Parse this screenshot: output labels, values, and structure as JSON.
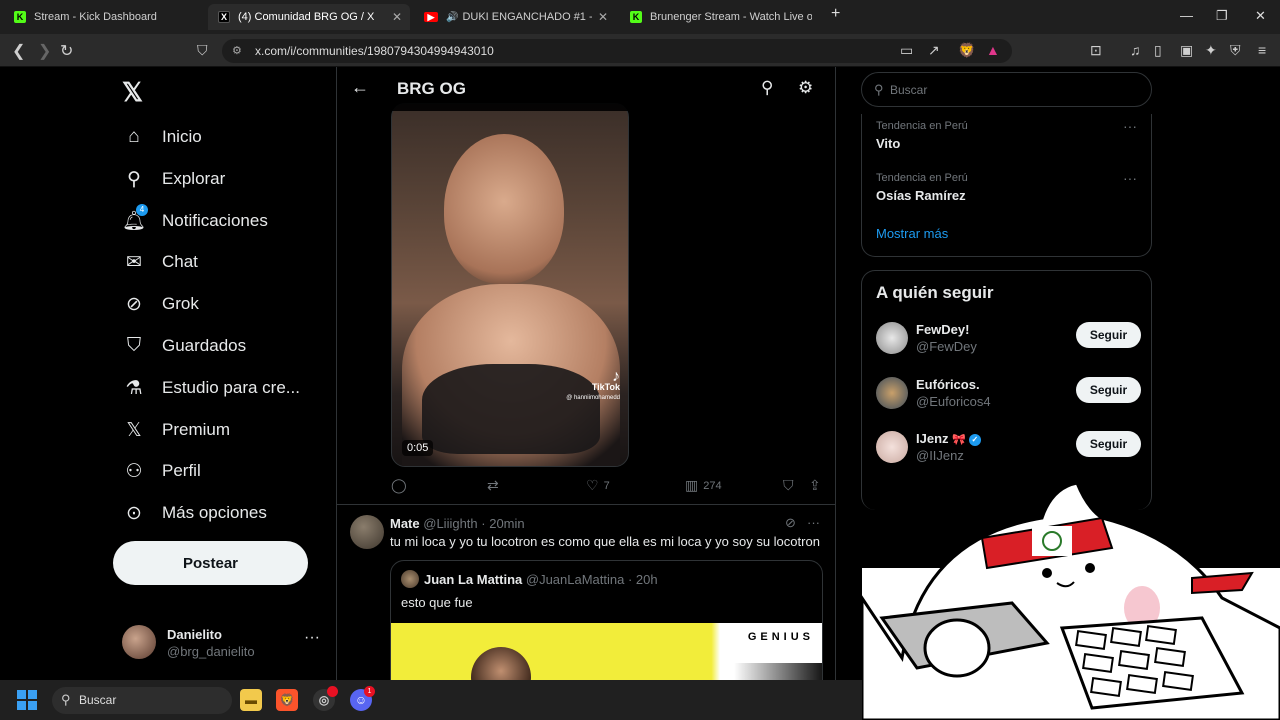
{
  "browser": {
    "tabs": [
      {
        "title": "Stream - Kick Dashboard",
        "icon": "kick-icon"
      },
      {
        "title": "(4) Comunidad BRG OG / X",
        "icon": "x-icon"
      },
      {
        "title": "DUKI ENGANCHADO #1 - Yo",
        "icon": "youtube-icon"
      },
      {
        "title": "Brunenger Stream - Watch Live on Ki",
        "icon": "kick-icon"
      }
    ],
    "url": "x.com/i/communities/1980794304994943010"
  },
  "nav": {
    "items": [
      {
        "label": "Inicio",
        "icon": "home-icon"
      },
      {
        "label": "Explorar",
        "icon": "search-icon"
      },
      {
        "label": "Notificaciones",
        "icon": "bell-icon",
        "badge": "4"
      },
      {
        "label": "Chat",
        "icon": "mail-icon"
      },
      {
        "label": "Grok",
        "icon": "grok-icon"
      },
      {
        "label": "Guardados",
        "icon": "bookmark-icon"
      },
      {
        "label": "Estudio para cre...",
        "icon": "flask-icon"
      },
      {
        "label": "Premium",
        "icon": "x-icon"
      },
      {
        "label": "Perfil",
        "icon": "person-icon"
      },
      {
        "label": "Más opciones",
        "icon": "more-icon"
      }
    ],
    "post_label": "Postear",
    "account": {
      "name": "Danielito",
      "handle": "@brg_danielito"
    }
  },
  "main": {
    "title": "BRG OG",
    "video": {
      "duration": "0:05",
      "tiktok_label": "TikTok",
      "tiktok_user": "@ hanniimohamedd"
    },
    "actions": {
      "likes": "7",
      "views": "274"
    },
    "tweet2": {
      "name": "Mate",
      "handle": "@Liiighth",
      "time": "· 20min",
      "text": "tu mi loca y yo tu locotron es como que ella es mi loca y yo soy su locotron",
      "quote": {
        "name": "Juan La Mattina",
        "handle": "@JuanLaMattina",
        "time": "· 20h",
        "text": "esto que fue",
        "image_text": "GENIUS"
      }
    }
  },
  "right": {
    "search_placeholder": "Buscar",
    "trends": [
      {
        "context": "Tendencia en Perú",
        "name": "Vito"
      },
      {
        "context": "Tendencia en Perú",
        "name": "Osías Ramírez"
      }
    ],
    "show_more": "Mostrar más",
    "who_to_follow_title": "A quién seguir",
    "follow": [
      {
        "name": "FewDey!",
        "handle": "@FewDey",
        "button": "Seguir"
      },
      {
        "name": "Eufóricos.",
        "handle": "@Euforicos4",
        "button": "Seguir"
      },
      {
        "name": "IJenz",
        "handle": "@IIJenz",
        "button": "Seguir",
        "verified": true
      }
    ]
  },
  "taskbar": {
    "search_placeholder": "Buscar",
    "discord_badge": "1"
  },
  "colors": {
    "accent": "#1d9bf0",
    "background": "#000000",
    "border": "#2f3336",
    "muted": "#71767b"
  }
}
